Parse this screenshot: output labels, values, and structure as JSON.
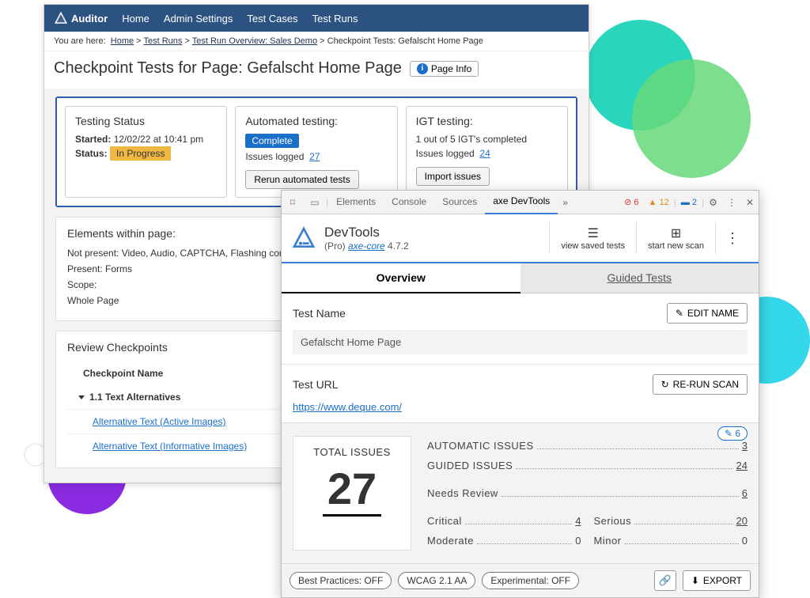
{
  "auditor": {
    "app_name": "Auditor",
    "nav": [
      "Home",
      "Admin Settings",
      "Test Cases",
      "Test Runs"
    ],
    "breadcrumb_label": "You are here:",
    "breadcrumb": [
      "Home",
      "Test Runs",
      "Test Run Overview: Sales Demo",
      "Checkpoint Tests: Gefalscht Home Page"
    ],
    "page_title": "Checkpoint Tests for Page: Gefalscht Home Page",
    "page_info_btn": "Page Info",
    "cards": {
      "status": {
        "title": "Testing Status",
        "started_label": "Started:",
        "started_value": "12/02/22 at 10:41 pm",
        "status_label": "Status:",
        "status_value": "In Progress"
      },
      "auto": {
        "title": "Automated testing:",
        "badge": "Complete",
        "issues_label": "Issues logged",
        "issues_count": "27",
        "button": "Rerun automated tests"
      },
      "igt": {
        "title": "IGT testing:",
        "summary": "1 out of 5 IGT's completed",
        "issues_label": "Issues logged",
        "issues_count": "24",
        "button": "Import issues"
      }
    },
    "elements_panel": {
      "title": "Elements within page:",
      "not_present": "Not present: Video, Audio, CAPTCHA, Flashing content",
      "present": "Present: Forms",
      "scope_label": "Scope:",
      "scope_value": "Whole Page"
    },
    "review_panel": {
      "title": "Review Checkpoints",
      "col_header": "Checkpoint Name",
      "group": "1.1 Text Alternatives",
      "items": [
        "Alternative Text (Active Images)",
        "Alternative Text (Informative Images)"
      ]
    }
  },
  "devtools": {
    "browser_tabs": [
      "Elements",
      "Console",
      "Sources",
      "axe DevTools"
    ],
    "counts": {
      "errors": "6",
      "warnings": "12",
      "info": "2"
    },
    "title": "DevTools",
    "subtitle_prefix": "(Pro) ",
    "subtitle_link": "axe-core",
    "subtitle_version": " 4.7.2",
    "actions": {
      "saved": "view saved tests",
      "new": "start new scan"
    },
    "main_tabs": {
      "overview": "Overview",
      "guided": "Guided Tests"
    },
    "test_name_label": "Test Name",
    "edit_name_btn": "EDIT NAME",
    "test_name_value": "Gefalscht Home Page",
    "test_url_label": "Test URL",
    "rerun_btn": "RE-RUN SCAN",
    "test_url_value": "https://www.deque.com/",
    "edit_count": "6",
    "total_label": "TOTAL ISSUES",
    "total_value": "27",
    "stats": {
      "automatic": {
        "label": "AUTOMATIC ISSUES",
        "value": "3"
      },
      "guided": {
        "label": "GUIDED ISSUES",
        "value": "24"
      },
      "needs_review": {
        "label": "Needs Review",
        "value": "6"
      },
      "critical": {
        "label": "Critical",
        "value": "4"
      },
      "serious": {
        "label": "Serious",
        "value": "20"
      },
      "moderate": {
        "label": "Moderate",
        "value": "0"
      },
      "minor": {
        "label": "Minor",
        "value": "0"
      }
    },
    "chips": {
      "bp": "Best Practices: OFF",
      "wcag": "WCAG 2.1 AA",
      "exp": "Experimental: OFF"
    },
    "export_btn": "EXPORT"
  }
}
